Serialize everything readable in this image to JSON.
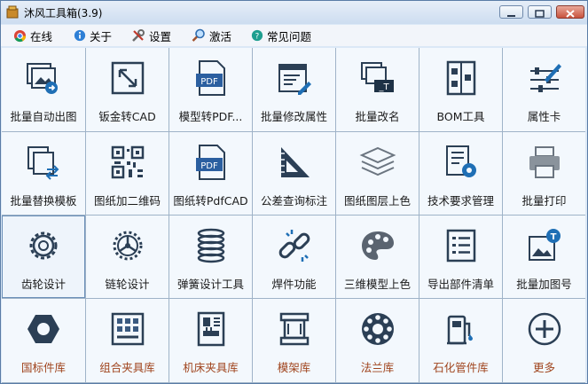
{
  "window": {
    "title": "沐风工具箱(3.9)"
  },
  "menu": [
    {
      "label": "在线",
      "icon": "chrome-icon"
    },
    {
      "label": "关于",
      "icon": "info-icon"
    },
    {
      "label": "设置",
      "icon": "wrench-tools-icon"
    },
    {
      "label": "激活",
      "icon": "magnifier-key-icon"
    },
    {
      "label": "常见问题",
      "icon": "help-icon"
    }
  ],
  "tiles": [
    {
      "label": "批量自动出图",
      "icon": "images-export-icon"
    },
    {
      "label": "钣金转CAD",
      "icon": "resize-arrow-icon"
    },
    {
      "label": "模型转PDF...",
      "icon": "pdf-file-icon"
    },
    {
      "label": "批量修改属性",
      "icon": "property-edit-icon"
    },
    {
      "label": "批量改名",
      "icon": "rename-icon"
    },
    {
      "label": "BOM工具",
      "icon": "bom-icon"
    },
    {
      "label": "属性卡",
      "icon": "sliders-icon"
    },
    {
      "label": "批量替换模板",
      "icon": "template-replace-icon"
    },
    {
      "label": "图纸加二维码",
      "icon": "qr-code-icon"
    },
    {
      "label": "图纸转PdfCAD",
      "icon": "pdf-file-icon"
    },
    {
      "label": "公差查询标注",
      "icon": "set-square-icon"
    },
    {
      "label": "图纸图层上色",
      "icon": "layers-icon"
    },
    {
      "label": "技术要求管理",
      "icon": "document-gear-icon"
    },
    {
      "label": "批量打印",
      "icon": "printer-icon"
    },
    {
      "label": "齿轮设计",
      "icon": "gear-icon"
    },
    {
      "label": "链轮设计",
      "icon": "sprocket-icon"
    },
    {
      "label": "弹簧设计工具",
      "icon": "spring-icon"
    },
    {
      "label": "焊件功能",
      "icon": "broken-link-icon"
    },
    {
      "label": "三维模型上色",
      "icon": "palette-icon"
    },
    {
      "label": "导出部件清单",
      "icon": "list-export-icon"
    },
    {
      "label": "批量加图号",
      "icon": "image-badge-icon"
    },
    {
      "label": "国标件库",
      "icon": "hex-nut-icon"
    },
    {
      "label": "组合夹具库",
      "icon": "fixture-grid-icon"
    },
    {
      "label": "机床夹具库",
      "icon": "machine-tool-icon"
    },
    {
      "label": "模架库",
      "icon": "mold-base-icon"
    },
    {
      "label": "法兰库",
      "icon": "flange-icon"
    },
    {
      "label": "石化管件库",
      "icon": "pipe-fitting-icon"
    },
    {
      "label": "更多",
      "icon": "plus-circle-icon"
    }
  ],
  "colors": {
    "icon": "#2b3f55",
    "accent": "#1f6fb5",
    "library_label": "#a0451e"
  }
}
